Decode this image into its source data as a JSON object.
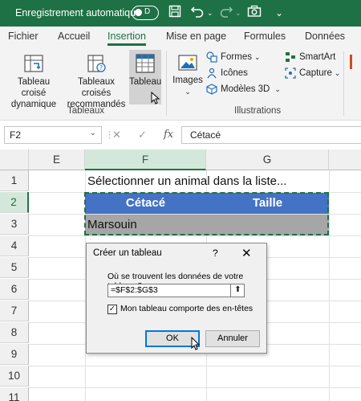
{
  "titlebar": {
    "autosave_label": "Enregistrement automatique",
    "autosave_state": "Désactivé",
    "autosave_knob": "D",
    "bg_color": "#1e7145"
  },
  "tabs": [
    {
      "label": "Fichier"
    },
    {
      "label": "Accueil"
    },
    {
      "label": "Insertion",
      "active": true
    },
    {
      "label": "Mise en page"
    },
    {
      "label": "Formules"
    },
    {
      "label": "Données"
    }
  ],
  "ribbon": {
    "pivot_table": "Tableau croisé dynamique",
    "pivot_table_l1": "Tableau croisé",
    "pivot_table_l2": "dynamique",
    "recommended_l1": "Tableaux croisés",
    "recommended_l2": "recommandés",
    "table": "Tableau",
    "group_tables": "Tableaux",
    "images": "Images",
    "shapes": "Formes",
    "icons": "Icônes",
    "models3d": "Modèles 3D",
    "smartart": "SmartArt",
    "capture": "Capture",
    "group_illustrations": "Illustrations"
  },
  "formula_bar": {
    "name_box": "F2",
    "cancel": "✕",
    "enter": "✓",
    "fx": "fx",
    "value": "Cétacé"
  },
  "grid": {
    "columns": [
      "E",
      "F",
      "G"
    ],
    "rows": [
      "1",
      "2",
      "3",
      "4",
      "5",
      "6",
      "7",
      "8",
      "9",
      "10",
      "11"
    ],
    "selected_column": "F",
    "selected_row": "2",
    "f1": "Sélectionner un animal dans la liste...",
    "f2": "Cétacé",
    "g2": "Taille",
    "f3": "Marsouin",
    "header_fill": "#4472c4",
    "data_fill": "#a6a6a6"
  },
  "dialog": {
    "title": "Créer un tableau",
    "help": "?",
    "close": "✕",
    "question": "Où se trouvent les données de votre tableau ?",
    "range_value": "=$F$2:$G$3",
    "checkbox_checked": true,
    "checkbox_label": "Mon tableau comporte des en-têtes",
    "ok": "OK",
    "cancel": "Annuler"
  }
}
